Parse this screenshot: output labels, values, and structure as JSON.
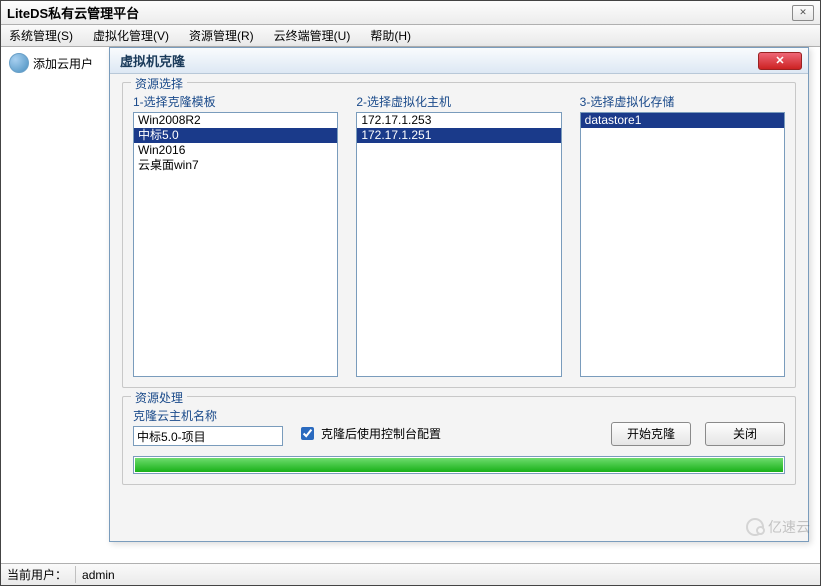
{
  "window": {
    "title": "LiteDS私有云管理平台",
    "close_hint": "✕"
  },
  "menu": {
    "system": "系统管理(S)",
    "virtualization": "虚拟化管理(V)",
    "resource": "资源管理(R)",
    "terminal": "云终端管理(U)",
    "help": "帮助(H)"
  },
  "sidebar": {
    "add_user": "添加云用户"
  },
  "dialog": {
    "title": "虚拟机克隆",
    "fieldset1": "资源选择",
    "col1_label": "1-选择克隆模板",
    "col2_label": "2-选择虚拟化主机",
    "col3_label": "3-选择虚拟化存储",
    "templates": [
      "Win2008R2",
      "中标5.0",
      "Win2016",
      "云桌面win7"
    ],
    "templates_selected_index": 1,
    "hosts": [
      "172.17.1.253",
      "172.17.1.251"
    ],
    "hosts_selected_index": 1,
    "datastores": [
      "datastore1"
    ],
    "datastores_selected_index": 0,
    "fieldset2": "资源处理",
    "name_label": "克隆云主机名称",
    "name_value": "中标5.0-项目",
    "checkbox_label": "克隆后使用控制台配置",
    "checkbox_checked": true,
    "start_btn": "开始克隆",
    "close_btn": "关闭",
    "progress_percent": 100
  },
  "status": {
    "label": "当前用户：",
    "user": "admin"
  },
  "watermark": {
    "text": "亿速云"
  }
}
